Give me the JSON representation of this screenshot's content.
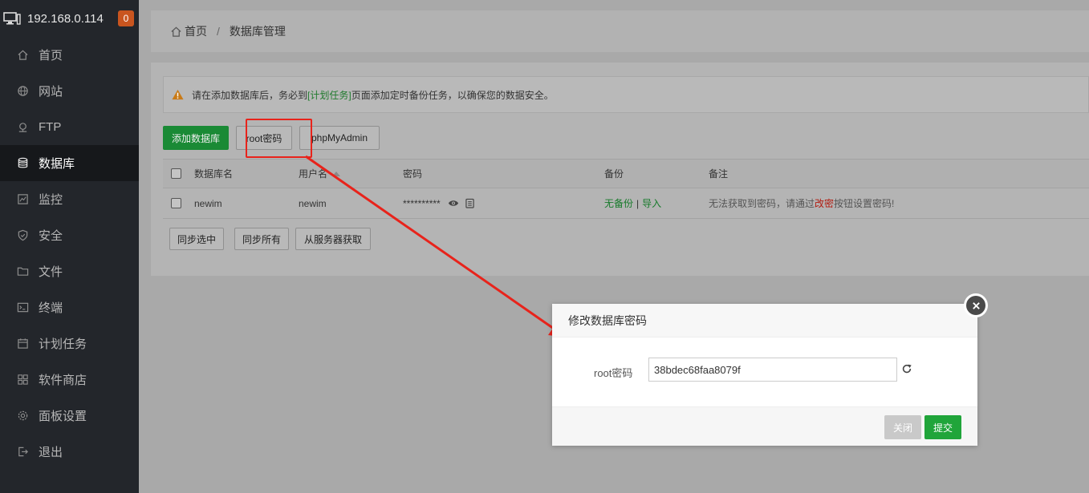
{
  "sidebar": {
    "host": "192.168.0.114",
    "badge": "0",
    "items": [
      {
        "label": "首页",
        "icon": "home-icon"
      },
      {
        "label": "网站",
        "icon": "globe-icon"
      },
      {
        "label": "FTP",
        "icon": "ftp-icon"
      },
      {
        "label": "数据库",
        "icon": "database-icon"
      },
      {
        "label": "监控",
        "icon": "monitor-icon"
      },
      {
        "label": "安全",
        "icon": "shield-icon"
      },
      {
        "label": "文件",
        "icon": "folder-icon"
      },
      {
        "label": "终端",
        "icon": "terminal-icon"
      },
      {
        "label": "计划任务",
        "icon": "calendar-icon"
      },
      {
        "label": "软件商店",
        "icon": "grid-icon"
      },
      {
        "label": "面板设置",
        "icon": "gear-icon"
      },
      {
        "label": "退出",
        "icon": "logout-icon"
      }
    ],
    "active_index": 3
  },
  "breadcrumb": {
    "home": "首页",
    "separator": "/",
    "current": "数据库管理"
  },
  "alert": {
    "before": "请在添加数据库后，务必到",
    "link": "[计划任务]",
    "after": "页面添加定时备份任务，以确保您的数据安全。"
  },
  "toolbar": {
    "add_db": "添加数据库",
    "root_pwd": "root密码",
    "phpmyadmin": "phpMyAdmin"
  },
  "table": {
    "headers": [
      "数据库名",
      "用户名",
      "密码",
      "备份",
      "备注"
    ],
    "rows": [
      {
        "db_name": "newim",
        "user": "newim",
        "password": "**********",
        "backup_none": "无备份",
        "backup_sep": "|",
        "backup_import": "导入",
        "note_before": "无法获取到密码，请通过",
        "note_link": "改密",
        "note_after": "按钮设置密码!"
      }
    ]
  },
  "sync": {
    "selected": "同步选中",
    "all": "同步所有",
    "from_server": "从服务器获取"
  },
  "modal": {
    "title": "修改数据库密码",
    "label": "root密码",
    "value": "38bdec68faa8079f",
    "close": "关闭",
    "submit": "提交"
  },
  "colors": {
    "annotation": "#e8231b",
    "primary": "#20a53a",
    "sidebar": "#23262b"
  }
}
